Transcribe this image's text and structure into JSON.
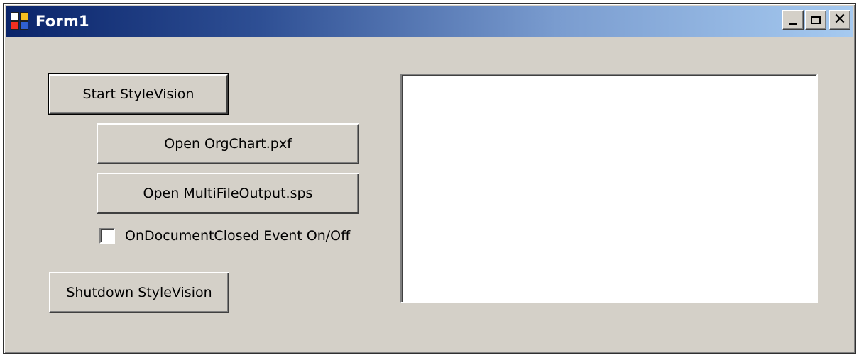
{
  "window": {
    "title": "Form1",
    "icon": "form-app-icon",
    "caption_buttons": [
      "minimize-icon",
      "maximize-icon",
      "close-icon"
    ],
    "close_glyph": "✕"
  },
  "buttons": {
    "start": "Start StyleVision",
    "open_orgchart": "Open OrgChart.pxf",
    "open_multifile": "Open MultiFileOutput.sps",
    "shutdown": "Shutdown StyleVision"
  },
  "checkbox": {
    "label": "OnDocumentClosed Event On/Off",
    "checked": false
  },
  "output_box": {
    "value": ""
  },
  "colors": {
    "form_background": "#d4d0c8",
    "titlebar_start": "#0a246a",
    "titlebar_end": "#a6caf0",
    "textbox_background": "#ffffff"
  }
}
